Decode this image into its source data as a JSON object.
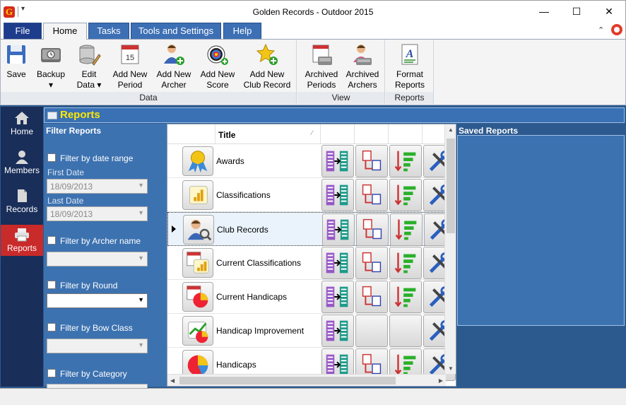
{
  "window": {
    "title": "Golden Records - Outdoor 2015",
    "app_glyph": "G",
    "qa_glyph": "▾",
    "minimize": "—",
    "maximize": "☐",
    "close": "✕"
  },
  "tabs": [
    {
      "label": "File"
    },
    {
      "label": "Home"
    },
    {
      "label": "Tasks"
    },
    {
      "label": "Tools and Settings"
    },
    {
      "label": "Help"
    }
  ],
  "ribbon_collapse_glyph": "⌃",
  "ribbon": {
    "groups": {
      "data": "Data",
      "view": "View",
      "reports": "Reports"
    },
    "buttons": {
      "save": "Save",
      "backup": "Backup\n▾",
      "edit_data": "Edit\nData ▾",
      "add_period": "Add New\nPeriod",
      "add_archer": "Add New\nArcher",
      "add_score": "Add New\nScore",
      "add_club_record": "Add New\nClub Record",
      "archived_periods": "Archived\nPeriods",
      "archived_archers": "Archived\nArchers",
      "format_reports": "Format\nReports"
    },
    "calendar_day": "15",
    "format_glyph": "A"
  },
  "nav": [
    {
      "label": "Home"
    },
    {
      "label": "Members"
    },
    {
      "label": "Records"
    },
    {
      "label": "Reports"
    }
  ],
  "reports": {
    "header": "Reports",
    "filter_title": "Filter Reports",
    "filters": {
      "date_range": "Filter by date range",
      "first_date_label": "First Date",
      "first_date": "18/09/2013",
      "last_date_label": "Last Date",
      "last_date": "18/09/2013",
      "archer": "Filter by Archer name",
      "round": "Filter by Round",
      "bow_class": "Filter by Bow Class",
      "category": "Filter by Category"
    },
    "grid": {
      "title_col": "Title",
      "rows": [
        {
          "title": "Awards",
          "actions": [
            true,
            true,
            true,
            true
          ]
        },
        {
          "title": "Classifications",
          "actions": [
            true,
            true,
            true,
            true
          ]
        },
        {
          "title": "Club Records",
          "actions": [
            true,
            true,
            true,
            true
          ],
          "selected": true
        },
        {
          "title": "Current Classifications",
          "actions": [
            true,
            true,
            true,
            true
          ]
        },
        {
          "title": "Current Handicaps",
          "actions": [
            true,
            true,
            true,
            true
          ]
        },
        {
          "title": "Handicap Improvement",
          "actions": [
            true,
            false,
            false,
            true
          ]
        },
        {
          "title": "Handicaps",
          "actions": [
            true,
            true,
            true,
            true
          ]
        }
      ]
    },
    "saved_title": "Saved Reports"
  }
}
